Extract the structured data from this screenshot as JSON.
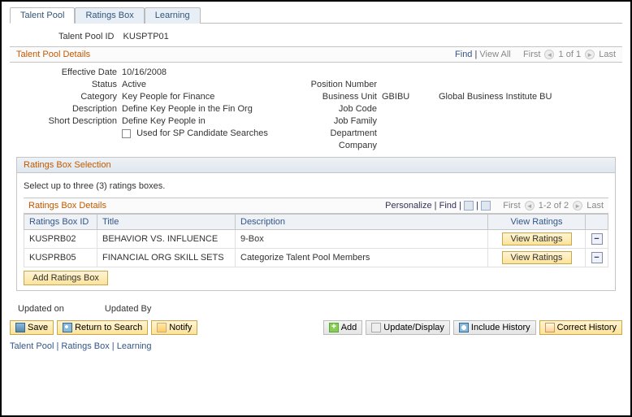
{
  "tabs": {
    "talent_pool": "Talent Pool",
    "ratings_box": "Ratings Box",
    "learning": "Learning"
  },
  "id_field": {
    "label": "Talent Pool ID",
    "value": "KUSPTP01"
  },
  "section": {
    "title": "Talent Pool Details",
    "nav": {
      "find": "Find",
      "view_all": "View All",
      "first": "First",
      "pager": "1 of 1",
      "last": "Last"
    }
  },
  "details": {
    "eff_date_l": "Effective Date",
    "eff_date_v": "10/16/2008",
    "status_l": "Status",
    "status_v": "Active",
    "category_l": "Category",
    "category_v": "Key People for Finance",
    "desc_l": "Description",
    "desc_v": "Define Key People in the Fin Org",
    "short_l": "Short Description",
    "short_v": "Define Key People in",
    "sp_chk": "Used for SP Candidate Searches",
    "posnum_l": "Position Number",
    "bu_l": "Business Unit",
    "bu_v": "GBIBU",
    "bu_desc": "Global Business Institute BU",
    "jobcode_l": "Job Code",
    "jobfam_l": "Job Family",
    "dept_l": "Department",
    "company_l": "Company"
  },
  "ratings_box": {
    "title": "Ratings Box Selection",
    "instruction": "Select up to three (3) ratings boxes.",
    "subtitle": "Ratings Box Details",
    "nav": {
      "personalize": "Personalize",
      "find": "Find",
      "first": "First",
      "pager": "1-2 of 2",
      "last": "Last"
    },
    "headers": {
      "id": "Ratings Box ID",
      "title": "Title",
      "desc": "Description",
      "view": "View Ratings"
    },
    "rows": [
      {
        "id": "KUSPRB02",
        "title": "BEHAVIOR VS. INFLUENCE",
        "desc": "9-Box",
        "btn": "View Ratings"
      },
      {
        "id": "KUSPRB05",
        "title": "FINANCIAL ORG SKILL SETS",
        "desc": "Categorize Talent Pool Members",
        "btn": "View Ratings"
      }
    ],
    "add_btn": "Add Ratings Box"
  },
  "meta": {
    "updated_on": "Updated on",
    "updated_by": "Updated By"
  },
  "actions": {
    "save": "Save",
    "return": "Return to Search",
    "notify": "Notify",
    "add": "Add",
    "update": "Update/Display",
    "include_hist": "Include History",
    "correct_hist": "Correct History"
  },
  "footer": {
    "talent_pool": "Talent Pool",
    "ratings_box": "Ratings Box",
    "learning": "Learning"
  }
}
